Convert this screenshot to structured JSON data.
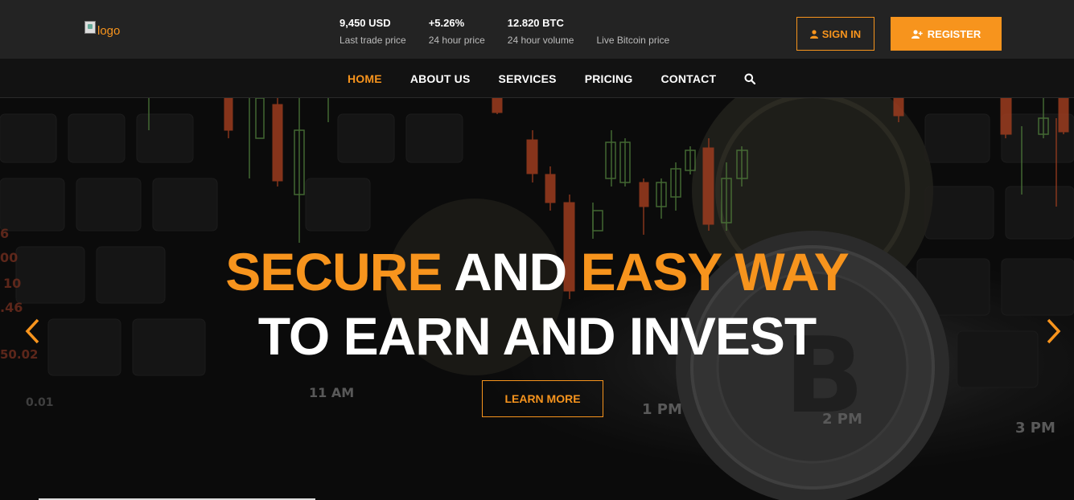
{
  "header": {
    "logo_alt": "logo",
    "stats": [
      {
        "value": "9,450 USD",
        "label": "Last trade price"
      },
      {
        "value": "+5.26%",
        "label": "24 hour price"
      },
      {
        "value": "12.820 BTC",
        "label": "24 hour volume"
      },
      {
        "value": "",
        "label": "Live Bitcoin price"
      }
    ],
    "signin_label": "SIGN IN",
    "register_label": "REGISTER"
  },
  "nav": {
    "items": [
      {
        "label": "HOME",
        "active": true
      },
      {
        "label": "ABOUT US"
      },
      {
        "label": "SERVICES"
      },
      {
        "label": "PRICING"
      },
      {
        "label": "CONTACT"
      }
    ],
    "search_icon": "search-icon"
  },
  "hero": {
    "line1_part1": "SECURE",
    "line1_part2": " AND ",
    "line1_part3": "EASY WAY",
    "line2": "TO EARN AND INVEST",
    "cta_label": "LEARN MORE",
    "bg_text": {
      "t1": "11 AM",
      "t2": "1 PM",
      "t3": "2 PM",
      "t4": "3 PM",
      "t5": "0.01",
      "s1": "6",
      "s2": "00",
      "s3": "10",
      "s4": ".46",
      "s5": "50.02"
    }
  },
  "colors": {
    "accent": "#f7941d",
    "topbar": "#232323",
    "navbar": "#121212"
  }
}
